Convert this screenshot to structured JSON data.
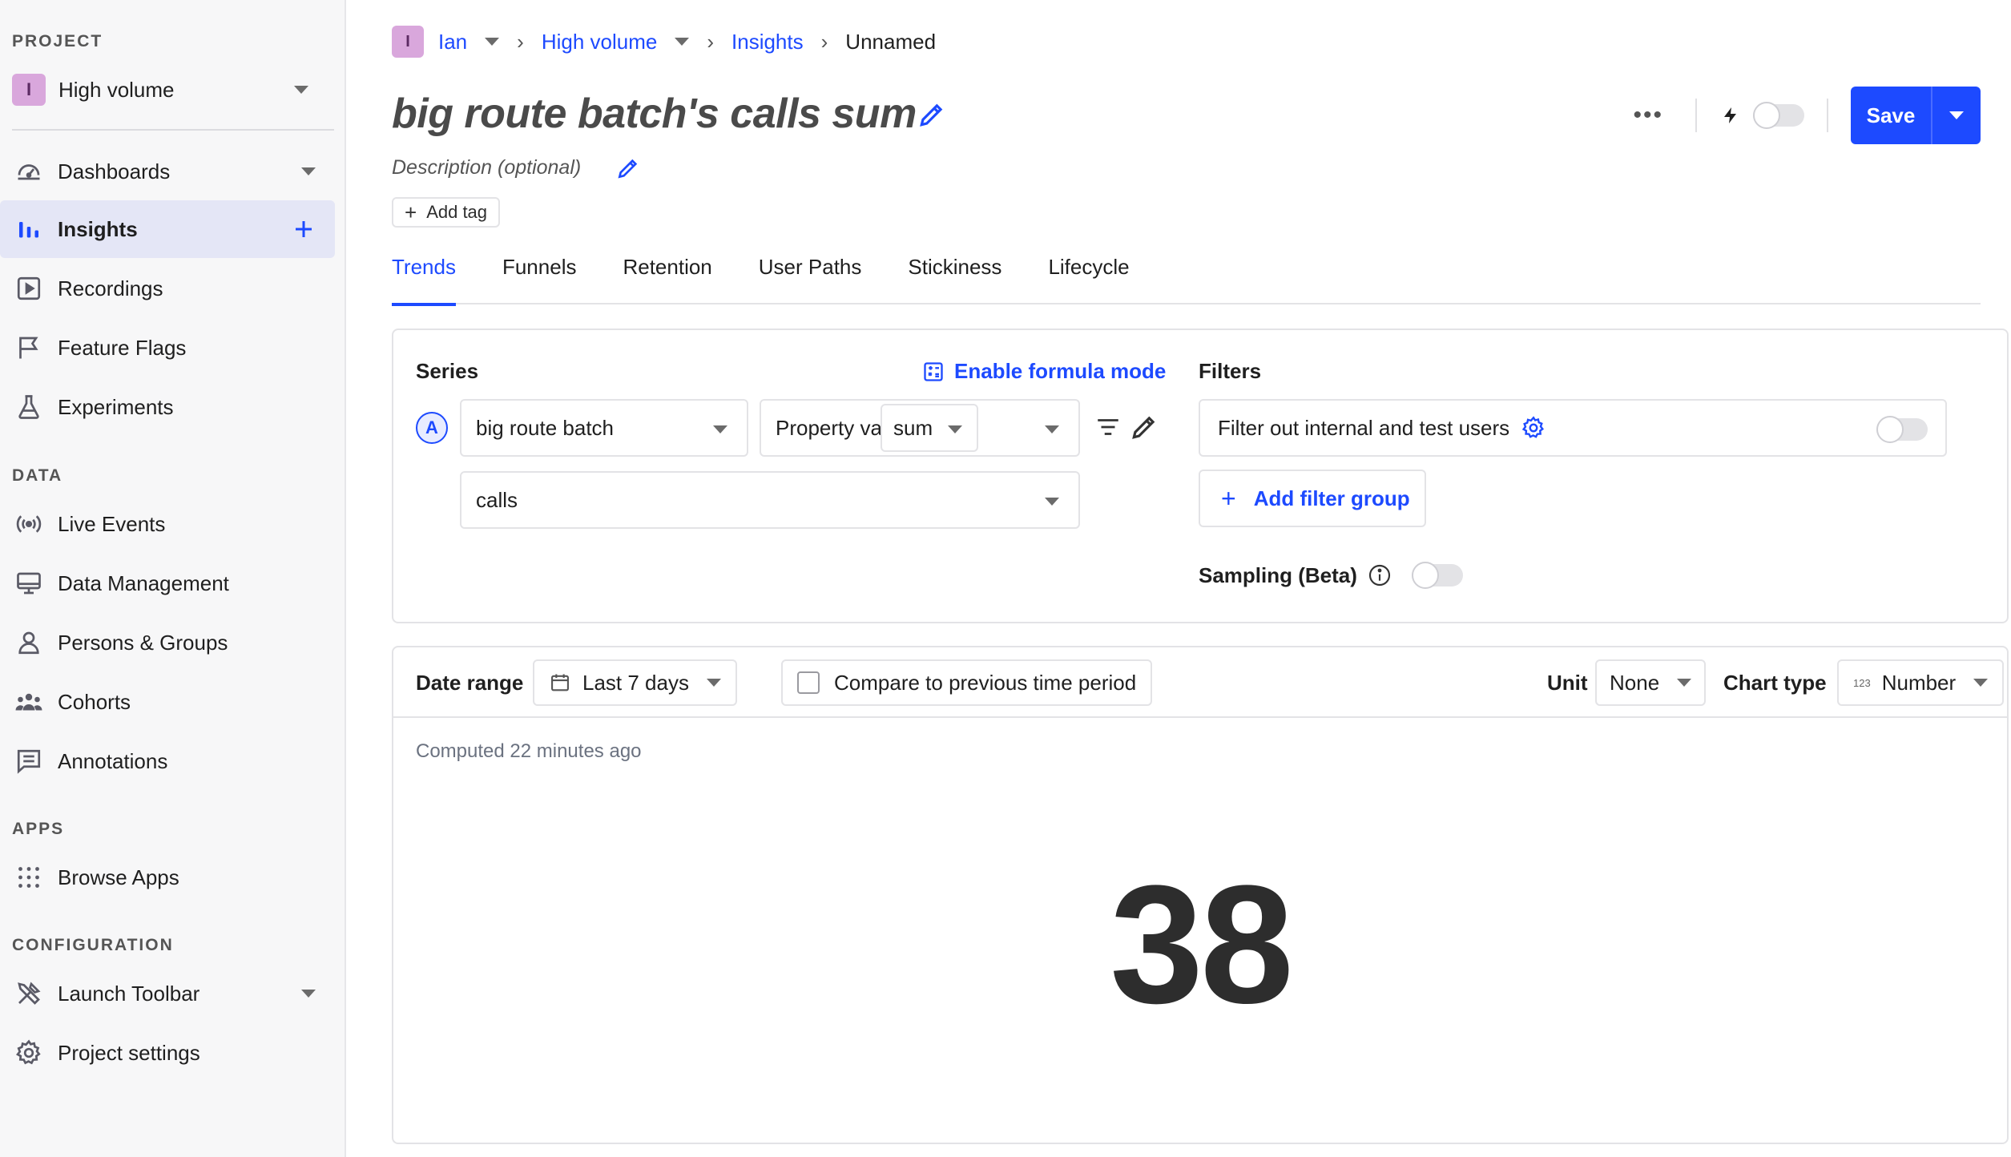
{
  "sidebar": {
    "project_section": "PROJECT",
    "project": {
      "avatar": "I",
      "name": "High volume"
    },
    "nav_top": [
      {
        "label": "Dashboards",
        "icon": "dashboard-icon"
      },
      {
        "label": "Insights",
        "icon": "insights-bar-icon"
      },
      {
        "label": "Recordings",
        "icon": "recordings-play-icon"
      },
      {
        "label": "Feature Flags",
        "icon": "flag-icon"
      },
      {
        "label": "Experiments",
        "icon": "flask-icon"
      }
    ],
    "data_section": "DATA",
    "nav_data": [
      {
        "label": "Live Events",
        "icon": "live-broadcast-icon"
      },
      {
        "label": "Data Management",
        "icon": "monitor-icon"
      },
      {
        "label": "Persons & Groups",
        "icon": "person-icon"
      },
      {
        "label": "Cohorts",
        "icon": "cohorts-icon"
      },
      {
        "label": "Annotations",
        "icon": "annotation-icon"
      }
    ],
    "apps_section": "APPS",
    "nav_apps": [
      {
        "label": "Browse Apps",
        "icon": "apps-grid-icon"
      }
    ],
    "config_section": "CONFIGURATION",
    "nav_config": [
      {
        "label": "Launch Toolbar",
        "icon": "tools-icon"
      },
      {
        "label": "Project settings",
        "icon": "gear-icon"
      }
    ]
  },
  "breadcrumb": {
    "avatar": "I",
    "user": "Ian",
    "project": "High volume",
    "section": "Insights",
    "current": "Unnamed"
  },
  "insight": {
    "title": "big route batch's calls sum",
    "description_placeholder": "Description (optional)",
    "add_tag": "Add tag"
  },
  "toolbar": {
    "more": "•••",
    "save_label": "Save",
    "live_toggle_on": false
  },
  "tabs": [
    "Trends",
    "Funnels",
    "Retention",
    "User Paths",
    "Stickiness",
    "Lifecycle"
  ],
  "active_tab": "Trends",
  "series": {
    "label": "Series",
    "formula_mode": "Enable formula mode",
    "items": [
      {
        "letter": "A",
        "event": "big route batch",
        "math": "Property value",
        "aggregation": "sum",
        "property": "calls"
      }
    ]
  },
  "filters": {
    "label": "Filters",
    "internal_filter": "Filter out internal and test users",
    "internal_filter_on": false,
    "add_filter_group": "Add filter group",
    "sampling": "Sampling (Beta)",
    "sampling_on": false
  },
  "result": {
    "date_range_label": "Date range",
    "date_range_value": "Last 7 days",
    "compare_label": "Compare to previous time period",
    "compare_checked": false,
    "unit_label": "Unit",
    "unit_value": "None",
    "chart_type_label": "Chart type",
    "chart_type_value": "Number",
    "chart_type_icon": "123",
    "computed": "Computed 22 minutes ago",
    "value": "38"
  },
  "colors": {
    "accent": "#1d4aff",
    "sidebar_bg": "#f7f7f8",
    "active_nav_bg": "#e4e6f6",
    "avatar_bg": "#d9a7dc"
  }
}
